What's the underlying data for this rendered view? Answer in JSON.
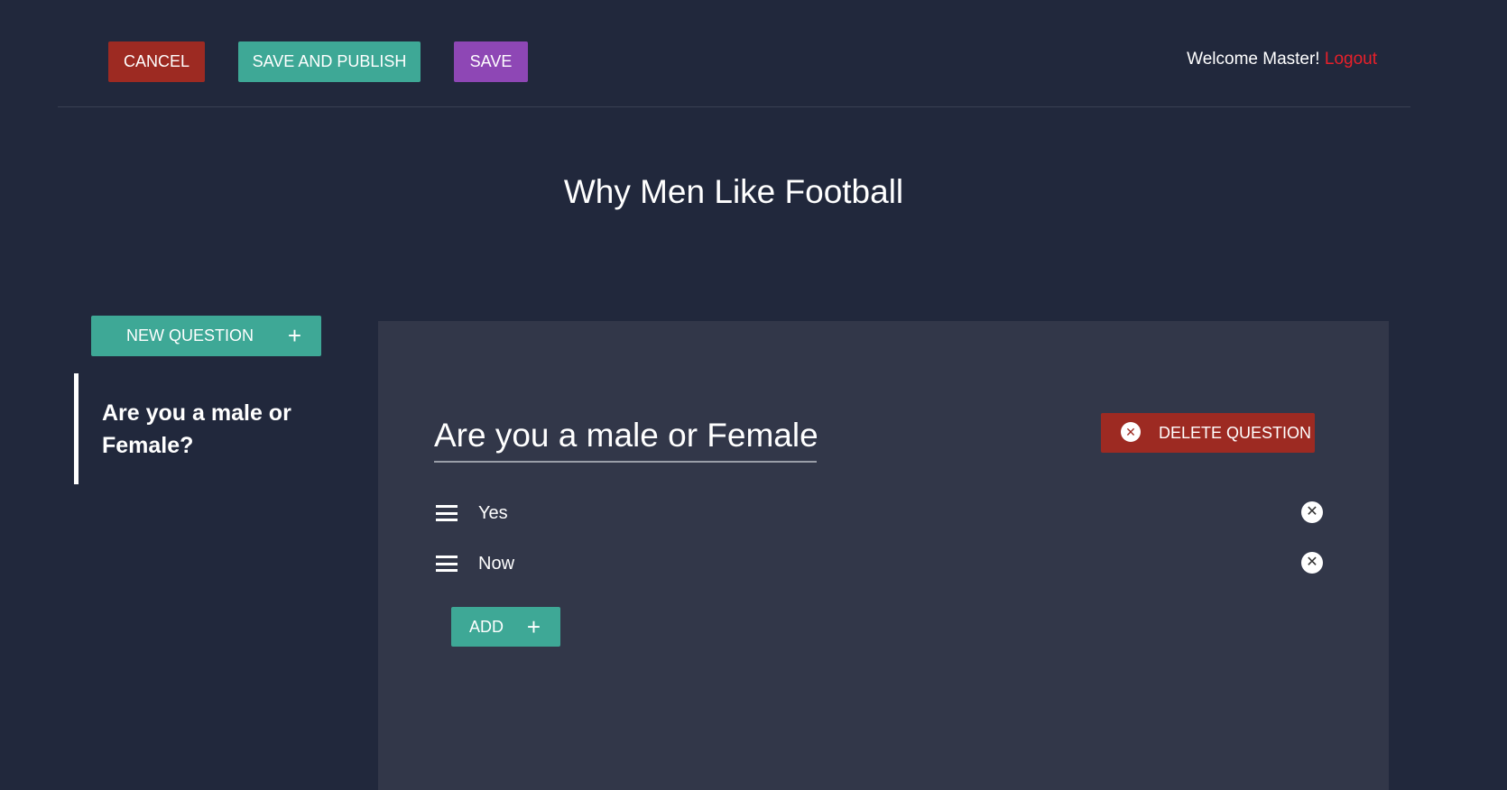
{
  "header": {
    "cancel": "CANCEL",
    "save_publish": "SAVE AND PUBLISH",
    "save": "SAVE",
    "welcome": "Welcome Master!",
    "logout": "Logout"
  },
  "survey_title": "Why Men Like Football",
  "sidebar": {
    "new_question": "NEW QUESTION",
    "plus": "+",
    "questions": [
      {
        "label": "Are you a male or Female?"
      }
    ]
  },
  "editor": {
    "question": "Are you a male or Female",
    "delete": "DELETE QUESTION",
    "options": [
      {
        "value": "Yes"
      },
      {
        "value": "Now"
      }
    ],
    "add": "ADD",
    "plus": "+",
    "remove_glyph": "✕"
  },
  "colors": {
    "background": "#21283c",
    "panel": "#323749",
    "teal": "#3ea896",
    "red": "#9d2a22",
    "purple": "#8e47b5",
    "logout": "#e8202a"
  }
}
